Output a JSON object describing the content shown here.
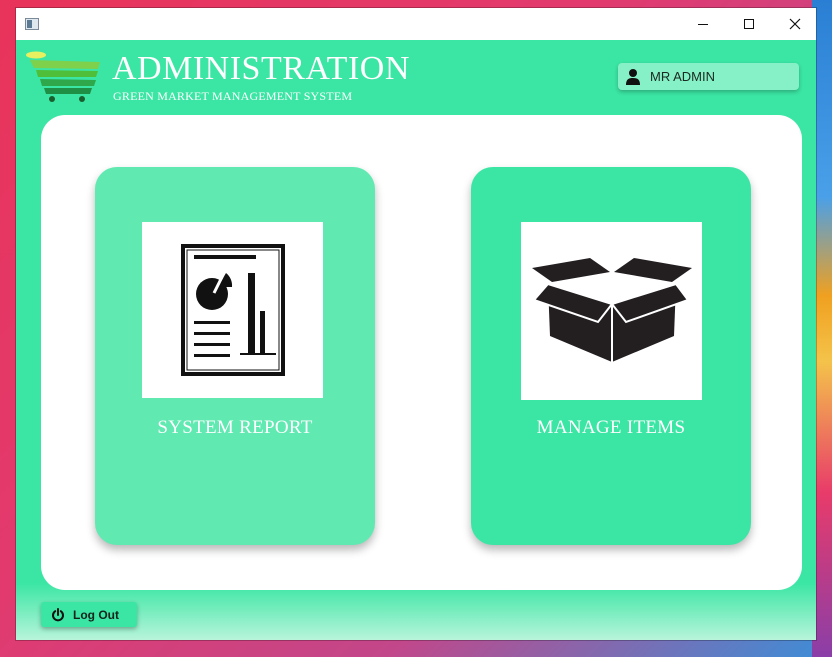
{
  "header": {
    "title": "ADMINISTRATION",
    "subtitle": "GREEN MARKET MANAGEMENT SYSTEM"
  },
  "user": {
    "name": "MR ADMIN",
    "icon": "user-icon"
  },
  "cards": [
    {
      "label": "SYSTEM REPORT",
      "icon": "report-icon"
    },
    {
      "label": "MANAGE ITEMS",
      "icon": "box-icon"
    }
  ],
  "footer": {
    "logout_label": "Log Out",
    "icon": "power-icon"
  },
  "colors": {
    "primary": "#3be6a4",
    "card_light": "#60e9b1",
    "badge": "#86f1c6",
    "panel": "#ffffff"
  }
}
